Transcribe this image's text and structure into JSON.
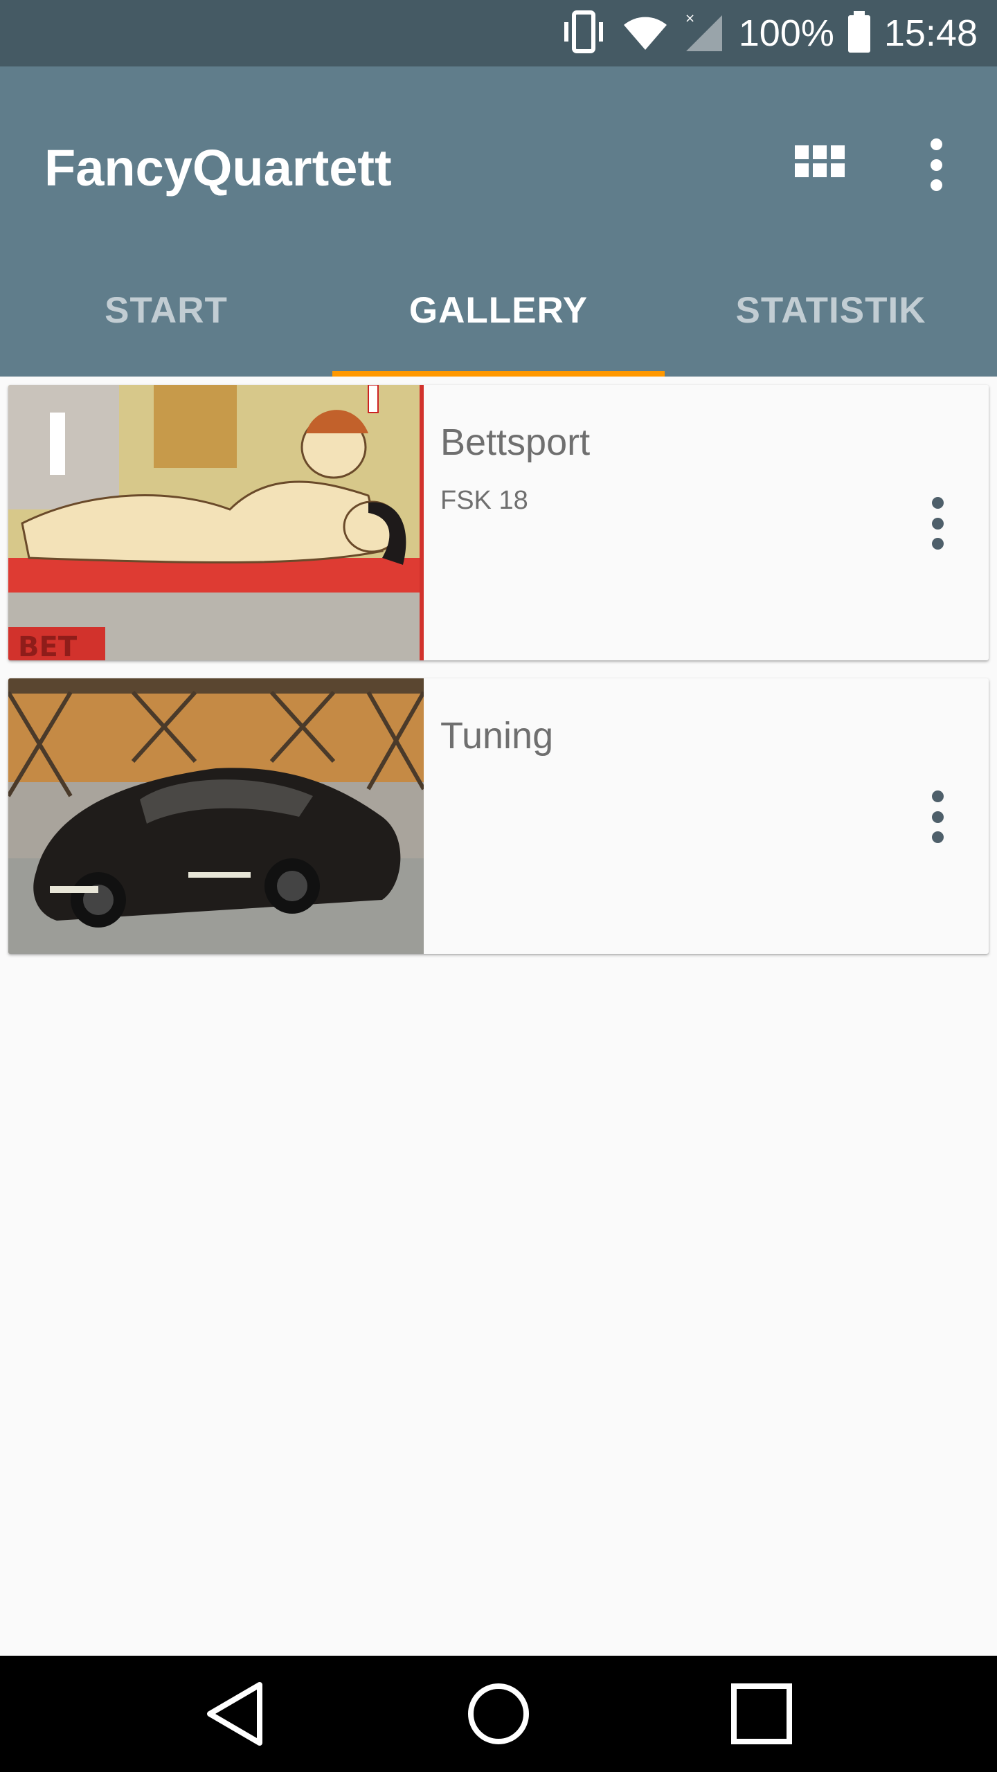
{
  "status_bar": {
    "battery_text": "100%",
    "time": "15:48",
    "icons": [
      "vibrate-icon",
      "wifi-icon",
      "signal-icon",
      "battery-icon"
    ]
  },
  "app_bar": {
    "title": "FancyQuartett",
    "actions": [
      "grid-view-icon",
      "overflow-menu-icon"
    ]
  },
  "tabs": [
    {
      "label": "START",
      "active": false
    },
    {
      "label": "GALLERY",
      "active": true
    },
    {
      "label": "STATISTIK",
      "active": false
    }
  ],
  "decks": [
    {
      "title": "Bettsport",
      "subtitle": "FSK 18",
      "image": "illustration-thumbnail"
    },
    {
      "title": "Tuning",
      "subtitle": "",
      "image": "car-photo-thumbnail"
    }
  ],
  "nav_bar": {
    "buttons": [
      "back-icon",
      "home-icon",
      "recents-icon"
    ]
  },
  "colors": {
    "status_bar": "#455a64",
    "app_bar": "#607d8b",
    "tab_indicator": "#ff9800",
    "background": "#fafafa"
  }
}
